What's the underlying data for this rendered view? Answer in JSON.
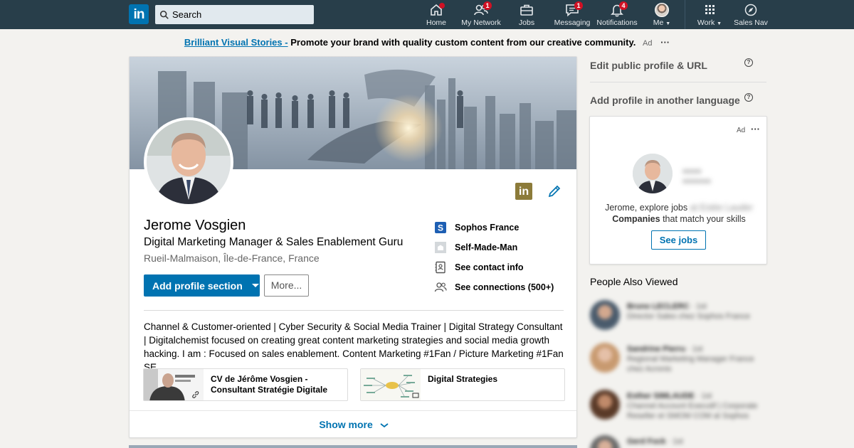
{
  "nav": {
    "search_placeholder": "Search",
    "items": [
      {
        "label": "Home",
        "badge": ""
      },
      {
        "label": "My Network",
        "badge": "1"
      },
      {
        "label": "Jobs",
        "badge": ""
      },
      {
        "label": "Messaging",
        "badge": "1"
      },
      {
        "label": "Notifications",
        "badge": "4"
      },
      {
        "label": "Me",
        "badge": ""
      },
      {
        "label": "Work",
        "badge": ""
      },
      {
        "label": "Sales Nav",
        "badge": ""
      }
    ],
    "logo_text": "in"
  },
  "top_ad": {
    "link": "Brilliant Visual Stories -",
    "text": "Promote your brand with quality custom content from our creative community.",
    "tag": "Ad",
    "more": "···"
  },
  "profile": {
    "name": "Jerome Vosgien",
    "headline": "Digital Marketing Manager & Sales Enablement Guru",
    "location": "Rueil-Malmaison, Île-de-France, France",
    "add_section_label": "Add profile section",
    "more_label": "More...",
    "in_badge": "in",
    "side_links": [
      {
        "label": "Sophos France",
        "icon": "sophos-logo"
      },
      {
        "label": "Self-Made-Man",
        "icon": "school-icon"
      },
      {
        "label": "See contact info",
        "icon": "contact-book-icon"
      },
      {
        "label": "See connections (500+)",
        "icon": "people-icon"
      }
    ],
    "summary": "Channel & Customer-oriented | Cyber Security & Social Media Trainer | Digital Strategy Consultant | Digitalchemist focused on creating great content marketing strategies and social media growth hacking. I am : Focused on sales enablement. Content Marketing #1Fan / Picture Marketing #1Fan SE...",
    "media": [
      {
        "title": "CV de Jérôme Vosgien - Consultant Stratégie Digitale"
      },
      {
        "title": "Digital Strategies"
      }
    ],
    "show_more": "Show more"
  },
  "right": {
    "edit_public": "Edit public profile & URL",
    "add_language": "Add profile in another language",
    "help_icon": "?",
    "ad": {
      "tag": "Ad",
      "more": "···",
      "blurred_company": "Estée Lauder",
      "message_prefix": "Jerome, explore jobs at Estée Lauder",
      "message_bold": "Companies",
      "message_suffix": " that match your skills",
      "button": "See jobs"
    },
    "people_also_viewed_title": "People Also Viewed",
    "people": [
      {
        "name": "Bruno LECLERC",
        "degree": "· 1st",
        "title": "Director Sales chez Sophos France"
      },
      {
        "name": "Sandrine Pierru",
        "degree": "· 1st",
        "title": "Regional Marketing Manager France chez Acronis"
      },
      {
        "name": "Esther SIMLAUDE",
        "degree": "· 1st",
        "title": "Channel Account Executif | Corporate Reseller et SMOM COM at Sophos"
      },
      {
        "name": "Gerd Fock",
        "degree": "· 1st",
        "title": ""
      }
    ]
  }
}
